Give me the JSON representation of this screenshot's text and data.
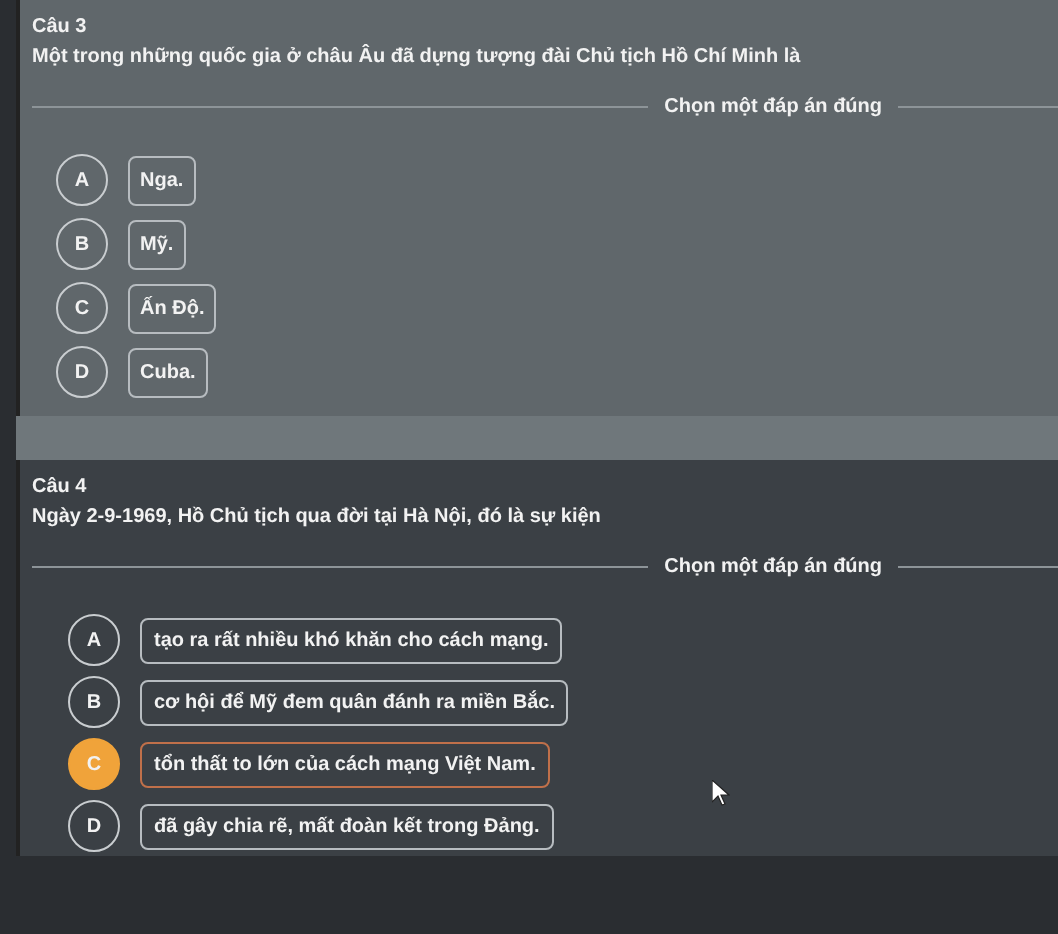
{
  "questions": [
    {
      "title": "Câu 3",
      "prompt": "Một trong những quốc gia ở châu Âu đã dựng tượng đài Chủ tịch Hồ Chí Minh là",
      "instruction": "Chọn một đáp án đúng",
      "options": [
        {
          "letter": "A",
          "text": "Nga.",
          "selected": false
        },
        {
          "letter": "B",
          "text": "Mỹ.",
          "selected": false
        },
        {
          "letter": "C",
          "text": "Ấn Độ.",
          "selected": false
        },
        {
          "letter": "D",
          "text": "Cuba.",
          "selected": false
        }
      ]
    },
    {
      "title": "Câu 4",
      "prompt": "Ngày 2-9-1969, Hồ Chủ tịch qua đời tại Hà Nội, đó là sự kiện",
      "instruction": "Chọn một đáp án đúng",
      "options": [
        {
          "letter": "A",
          "text": "tạo ra rất nhiều khó khăn cho cách mạng.",
          "selected": false
        },
        {
          "letter": "B",
          "text": "cơ hội để Mỹ đem quân đánh ra miền Bắc.",
          "selected": false
        },
        {
          "letter": "C",
          "text": "tổn thất to lớn của cách mạng Việt Nam.",
          "selected": true
        },
        {
          "letter": "D",
          "text": "đã gây chia rẽ, mất đoàn kết trong Đảng.",
          "selected": false
        }
      ]
    }
  ]
}
